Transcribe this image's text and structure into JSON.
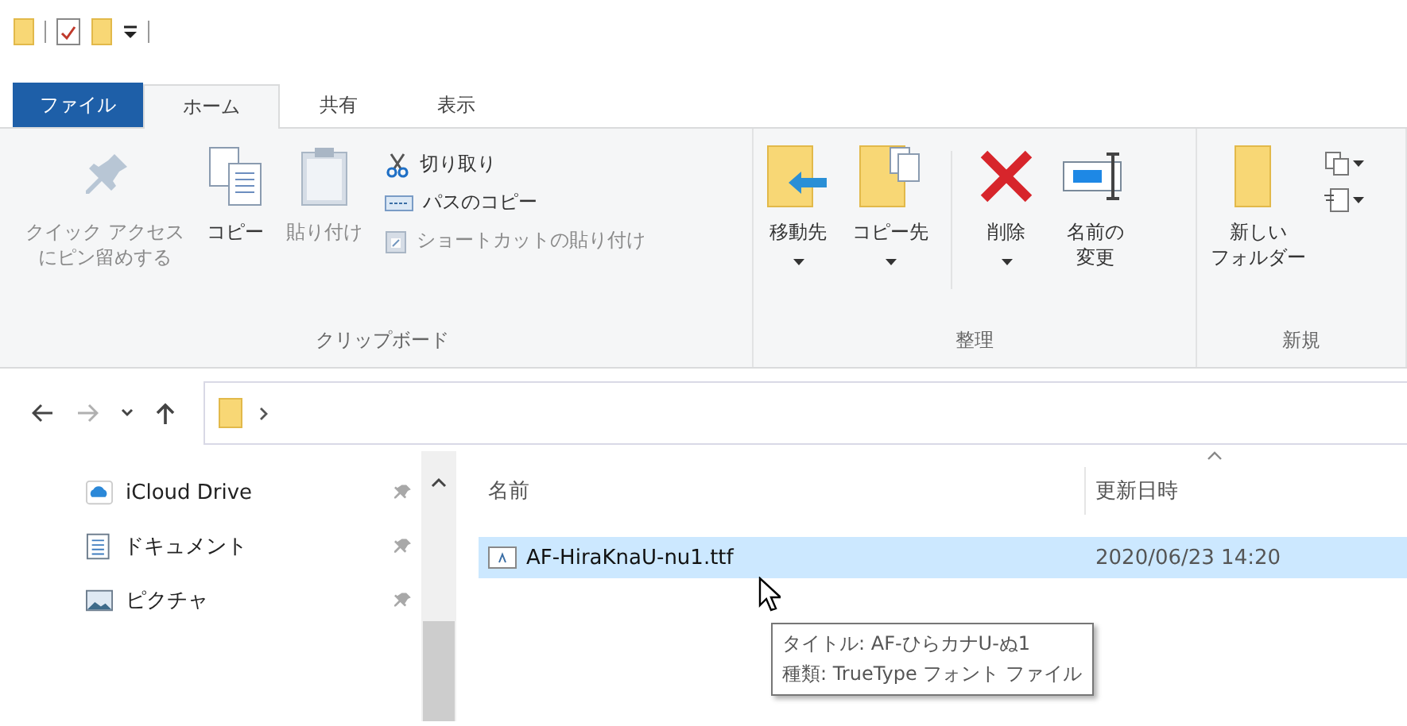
{
  "tabs": [
    {
      "label": "ファイル",
      "kind": "file",
      "selected": false
    },
    {
      "label": "ホーム",
      "kind": "tab",
      "selected": true
    },
    {
      "label": "共有",
      "kind": "tab",
      "selected": false
    },
    {
      "label": "表示",
      "kind": "tab",
      "selected": false
    }
  ],
  "ribbon": {
    "groups": [
      {
        "label": "クリップボード",
        "items": [
          {
            "kind": "large",
            "lines": [
              "クイック アクセス",
              "にピン留めする"
            ],
            "disabled": true,
            "dropdown": false
          },
          {
            "kind": "large",
            "label": "コピー",
            "disabled": false,
            "dropdown": false
          },
          {
            "kind": "large",
            "label": "貼り付け",
            "disabled": true,
            "dropdown": false
          },
          {
            "kind": "small",
            "label": "切り取り",
            "disabled": false,
            "dropdown": false
          },
          {
            "kind": "small",
            "label": "パスのコピー",
            "disabled": false,
            "dropdown": false
          },
          {
            "kind": "small",
            "label": "ショートカットの貼り付け",
            "disabled": true,
            "dropdown": false
          }
        ]
      },
      {
        "label": "整理",
        "items": [
          {
            "kind": "large",
            "label": "移動先",
            "disabled": false,
            "dropdown": true
          },
          {
            "kind": "large",
            "label": "コピー先",
            "disabled": false,
            "dropdown": true
          },
          {
            "kind": "large",
            "label": "削除",
            "disabled": false,
            "dropdown": true
          },
          {
            "kind": "large",
            "lines": [
              "名前の",
              "変更"
            ],
            "disabled": false,
            "dropdown": false
          }
        ]
      },
      {
        "label": "新規",
        "items": [
          {
            "kind": "large",
            "lines": [
              "新しい",
              "フォルダー"
            ],
            "disabled": false,
            "dropdown": false
          },
          {
            "kind": "icon",
            "disabled": false,
            "dropdown": true
          },
          {
            "kind": "icon",
            "disabled": false,
            "dropdown": true
          }
        ]
      }
    ]
  },
  "navigation": {
    "buttons": [
      {
        "kind": "back",
        "disabled": false
      },
      {
        "kind": "forward",
        "disabled": true
      },
      {
        "kind": "recent",
        "disabled": false
      },
      {
        "kind": "up",
        "disabled": false
      }
    ]
  },
  "sidebar": {
    "items": [
      {
        "label": "iCloud Drive",
        "pinned": true
      },
      {
        "label": "ドキュメント",
        "pinned": true
      },
      {
        "label": "ピクチャ",
        "pinned": true
      }
    ]
  },
  "file_list": {
    "columns": [
      {
        "label": "名前",
        "sorted": false
      },
      {
        "label": "更新日時",
        "sorted": true
      }
    ],
    "rows": [
      {
        "name": "AF-HiraKnaU-nu1.ttf",
        "modified": "2020/06/23 14:20",
        "selected": true
      }
    ]
  },
  "tooltip": {
    "lines": [
      "タイトル: AF-ひらカナU-ぬ1",
      "種類: TrueType フォント ファイル"
    ]
  }
}
